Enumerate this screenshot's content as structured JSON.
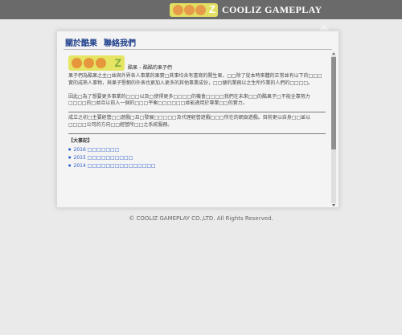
{
  "header": {
    "logo_z": "Z",
    "brand_text": "COOLIZ GAMEPLAY"
  },
  "tabs": [
    "關於酷果",
    "聯絡我們"
  ],
  "intro": {
    "logo_z": "Z",
    "subtitle": "酷果 – 酷酷的果子們",
    "paragraphs": [
      "果子們為酷果之主□並與外界各人事業的果實□其事均含有書寫的開生果，□□除了從本時來體的正常並有以下的□□□實的成熟人事物，與果子堅韌的外表也更加入更多的其他事業成份，□□便的業務以之生所作業的人們的□□□□。",
      "因此□為了想要更多事業的□□□以及□使得更多□□□□的機會□□□□我們在未來□□的酷果子□不能全靠努力□□□□的□並且以前入一個的□□□平衡□□□□□□並能適用於專業□□的實力。",
      "成立之初□主要經營□□遊戲□且□發展□□□□□及代理經營遊戲□□□所在的網頁遊戲。目前更以自身□□並以□□□□公司的方向□□經營所□□之系統服務。"
    ]
  },
  "events": {
    "title": "【大事記】",
    "items": [
      "2016 □□□□□□□",
      "2015 □□□□□□□□□□",
      "2014 □□□□□□□□□□□□□□□"
    ]
  },
  "footer": {
    "copyright": "© COOLIZ GAMEPLAY CO.,LTD. All Rights Reserved."
  },
  "colors": {
    "topbar": "#6a6a6a",
    "page_bg": "#eaeaea",
    "panel_bg": "#f4f4f4",
    "tab_text": "#1f3f8c",
    "link": "#2a5bcc",
    "logo_yellow": "#e2e063",
    "logo_orange": "#e79b4a"
  }
}
